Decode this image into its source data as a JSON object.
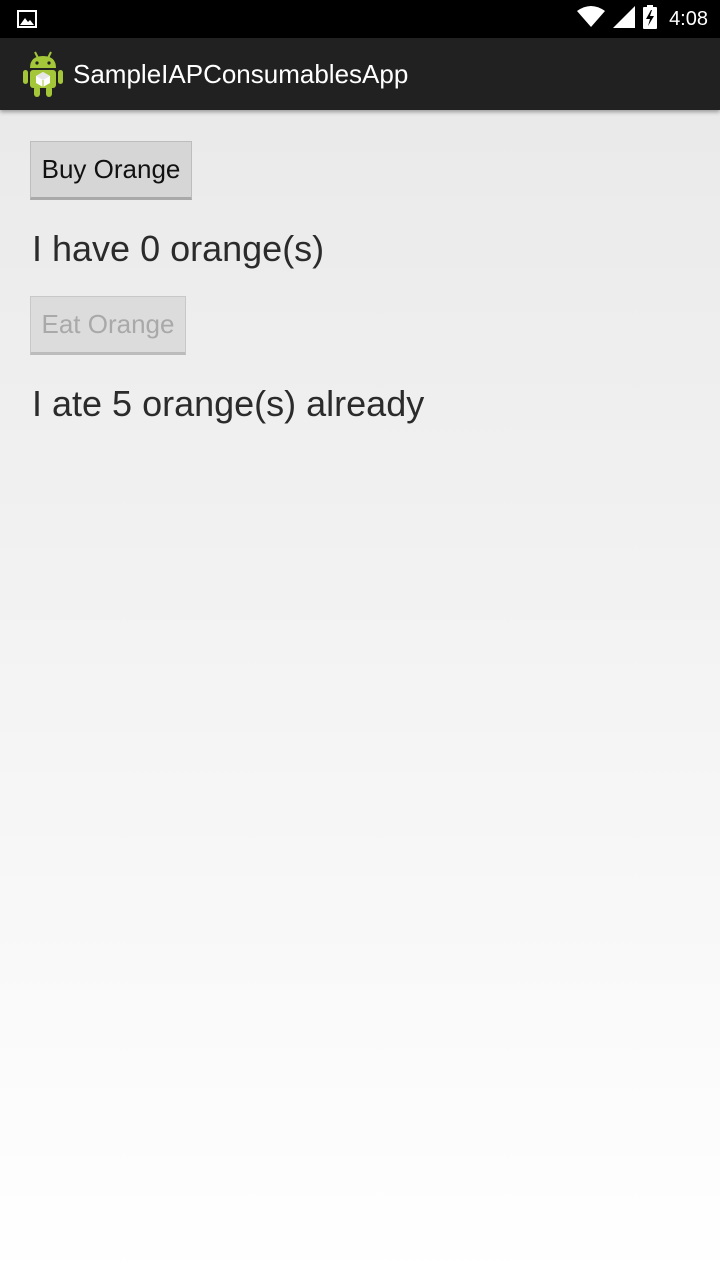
{
  "status_bar": {
    "time": "4:08",
    "icons": [
      "image-notification-icon",
      "wifi-icon",
      "cell-signal-icon",
      "battery-charging-icon"
    ]
  },
  "action_bar": {
    "title": "SampleIAPConsumablesApp",
    "icon": "android-app-icon"
  },
  "main": {
    "buy_button_label": "Buy Orange",
    "have_text": "I have 0 orange(s)",
    "eat_button_label": "Eat Orange",
    "eat_button_enabled": false,
    "ate_text": "I ate 5 orange(s) already"
  },
  "colors": {
    "status_bar_bg": "#000000",
    "action_bar_bg": "#212121",
    "android_green": "#a4c639"
  }
}
